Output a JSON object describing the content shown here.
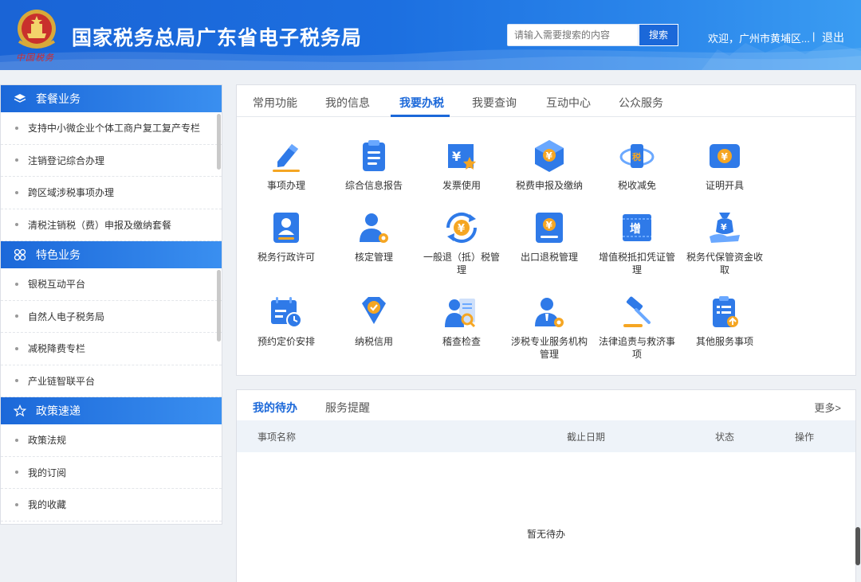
{
  "header": {
    "title": "国家税务总局广东省电子税务局",
    "emblem_caption": "中国税务",
    "search_placeholder": "请输入需要搜索的内容",
    "search_button": "搜索",
    "welcome": "欢迎，广州市黄埔区...",
    "divider": "|",
    "logout": "退出"
  },
  "sidebar": {
    "sections": [
      {
        "title": "套餐业务",
        "icon": "layers-icon",
        "items": [
          "支持中小微企业个体工商户复工复产专栏",
          "注销登记综合办理",
          "跨区域涉税事项办理",
          "清税注销税（费）申报及缴纳套餐"
        ]
      },
      {
        "title": "特色业务",
        "icon": "grid-icon",
        "items": [
          "银税互动平台",
          "自然人电子税务局",
          "减税降费专栏",
          "产业链智联平台"
        ]
      },
      {
        "title": "政策速递",
        "icon": "star-icon",
        "items": [
          "政策法规",
          "我的订阅",
          "我的收藏"
        ]
      }
    ]
  },
  "tabs": [
    "常用功能",
    "我的信息",
    "我要办税",
    "我要查询",
    "互动中心",
    "公众服务"
  ],
  "active_tab": "我要办税",
  "functions": [
    {
      "label": "事项办理",
      "icon": "pen-icon"
    },
    {
      "label": "综合信息报告",
      "icon": "report-icon"
    },
    {
      "label": "发票使用",
      "icon": "invoice-icon"
    },
    {
      "label": "税费申报及缴纳",
      "icon": "tax-declare-icon"
    },
    {
      "label": "税收减免",
      "icon": "tax-relief-icon"
    },
    {
      "label": "证明开具",
      "icon": "certificate-icon"
    },
    {
      "label": "税务行政许可",
      "icon": "license-icon"
    },
    {
      "label": "核定管理",
      "icon": "user-gear-icon"
    },
    {
      "label": "一般退（抵）税管理",
      "icon": "refund-icon"
    },
    {
      "label": "出口退税管理",
      "icon": "export-refund-icon"
    },
    {
      "label": "增值税抵扣凭证管理",
      "icon": "vat-voucher-icon"
    },
    {
      "label": "税务代保管资金收取",
      "icon": "money-bag-icon"
    },
    {
      "label": "预约定价安排",
      "icon": "calendar-icon"
    },
    {
      "label": "纳税信用",
      "icon": "credit-icon"
    },
    {
      "label": "稽查检查",
      "icon": "inspect-icon"
    },
    {
      "label": "涉税专业服务机构管理",
      "icon": "agency-icon"
    },
    {
      "label": "法律追责与救济事项",
      "icon": "gavel-icon"
    },
    {
      "label": "其他服务事项",
      "icon": "other-service-icon"
    }
  ],
  "todo": {
    "tabs": [
      "我的待办",
      "服务提醒"
    ],
    "more": "更多>",
    "columns": [
      "事项名称",
      "截止日期",
      "状态",
      "操作"
    ],
    "empty": "暂无待办"
  },
  "colors": {
    "primary": "#1b68d9",
    "accent_orange": "#f5a623",
    "header_light": "#3a9cf2"
  }
}
